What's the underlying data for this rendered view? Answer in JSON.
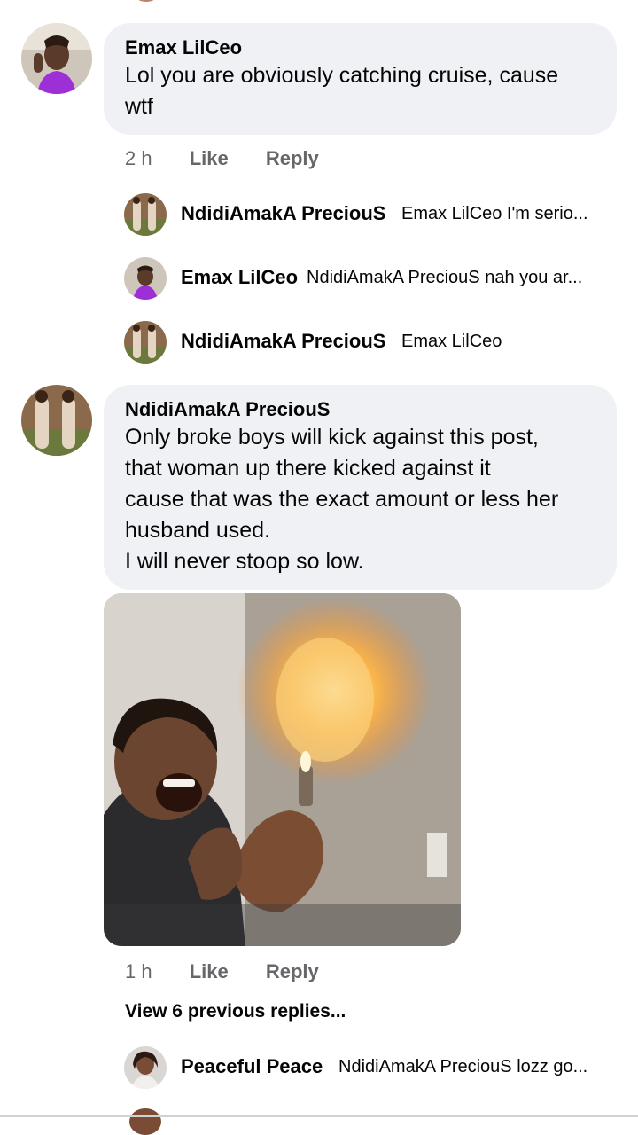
{
  "comments": [
    {
      "author": "Emax LilCeo",
      "text": "Lol you are obviously catching cruise, cause\nwtf",
      "time": "2 h",
      "like": "Like",
      "reply": "Reply"
    },
    {
      "author": "NdidiAmakA PreciouS",
      "text": "Only broke boys will kick against this post,\nthat woman up there  kicked against it\ncause that was the exact amount or less her\nhusband used.\nI will never stoop so low.",
      "time": "1 h",
      "like": "Like",
      "reply": "Reply"
    }
  ],
  "replies_block1": [
    {
      "name": "NdidiAmakA PreciouS",
      "text": "Emax LilCeo  I'm serio..."
    },
    {
      "name": "Emax LilCeo",
      "text": "NdidiAmakA PreciouS nah you ar..."
    },
    {
      "name": "NdidiAmakA PreciouS",
      "text": "Emax LilCeo"
    }
  ],
  "view_more": "View 6 previous replies...",
  "replies_block2": [
    {
      "name": "Peaceful Peace",
      "text": "NdidiAmakA PreciouS lozz go..."
    }
  ],
  "colors": {
    "bubble": "#eff1f5",
    "meta": "#65676b",
    "text": "#050505"
  }
}
